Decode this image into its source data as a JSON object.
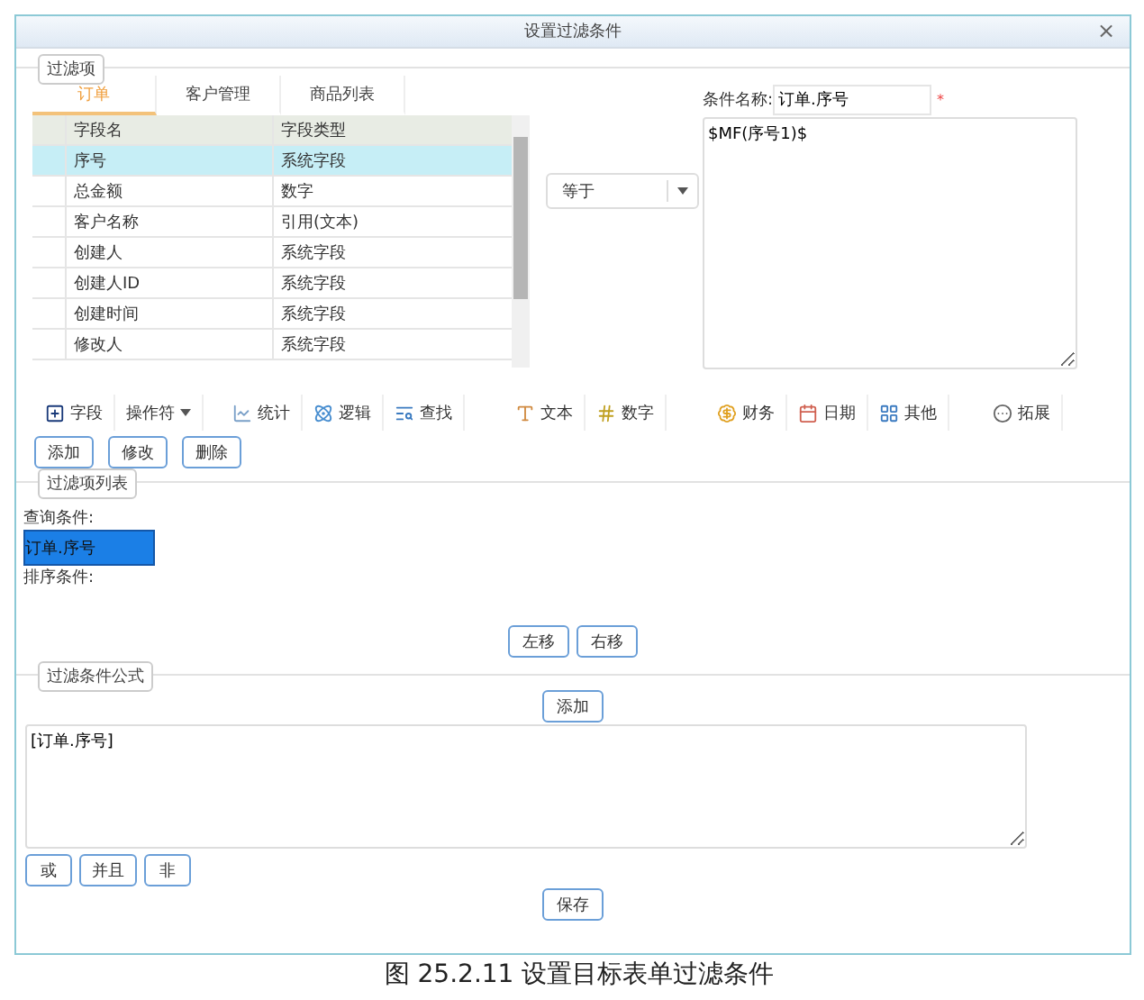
{
  "window": {
    "title": "设置过滤条件",
    "close": "×"
  },
  "filter_item": {
    "legend": "过滤项",
    "tabs": [
      {
        "label": "订单",
        "selected": true
      },
      {
        "label": "客户管理",
        "selected": false
      },
      {
        "label": "商品列表",
        "selected": false
      }
    ],
    "table": {
      "columns": [
        "字段名",
        "字段类型"
      ],
      "rows": [
        {
          "cells": [
            "序号",
            "系统字段"
          ],
          "selected": true
        },
        {
          "cells": [
            "总金额",
            "数字"
          ],
          "selected": false
        },
        {
          "cells": [
            "客户名称",
            "引用(文本)"
          ],
          "selected": false
        },
        {
          "cells": [
            "创建人",
            "系统字段"
          ],
          "selected": false
        },
        {
          "cells": [
            "创建人ID",
            "系统字段"
          ],
          "selected": false
        },
        {
          "cells": [
            "创建时间",
            "系统字段"
          ],
          "selected": false
        },
        {
          "cells": [
            "修改人",
            "系统字段"
          ],
          "selected": false
        }
      ]
    },
    "operator": {
      "value": "等于"
    },
    "condition_name": {
      "label": "条件名称:",
      "value": "订单.序号",
      "required": "*"
    },
    "formula": {
      "value": "$MF(序号1)$"
    },
    "toolbar": [
      {
        "kind": "plus",
        "label": "字段"
      },
      {
        "kind": "dropdown",
        "label": "操作符"
      },
      {
        "kind": "chart",
        "label": "统计"
      },
      {
        "kind": "atom",
        "label": "逻辑"
      },
      {
        "kind": "search",
        "label": "查找"
      },
      {
        "kind": "text",
        "label": "文本"
      },
      {
        "kind": "number",
        "label": "数字"
      },
      {
        "kind": "money",
        "label": "财务"
      },
      {
        "kind": "calendar",
        "label": "日期"
      },
      {
        "kind": "grid",
        "label": "其他"
      },
      {
        "kind": "more",
        "label": "拓展"
      }
    ],
    "buttons": [
      "添加",
      "修改",
      "删除"
    ]
  },
  "filter_list": {
    "legend": "过滤项列表",
    "query_label": "查询条件:",
    "query_items": [
      {
        "label": "订单.序号",
        "selected": true
      }
    ],
    "sort_label": "排序条件:",
    "buttons": [
      "左移",
      "右移"
    ]
  },
  "filter_formula": {
    "legend": "过滤条件公式",
    "add_button": "添加",
    "value": "[订单.序号]",
    "operators": [
      "或",
      "并且",
      "非"
    ],
    "save_button": "保存"
  },
  "caption": "图 25.2.11  设置目标表单过滤条件"
}
